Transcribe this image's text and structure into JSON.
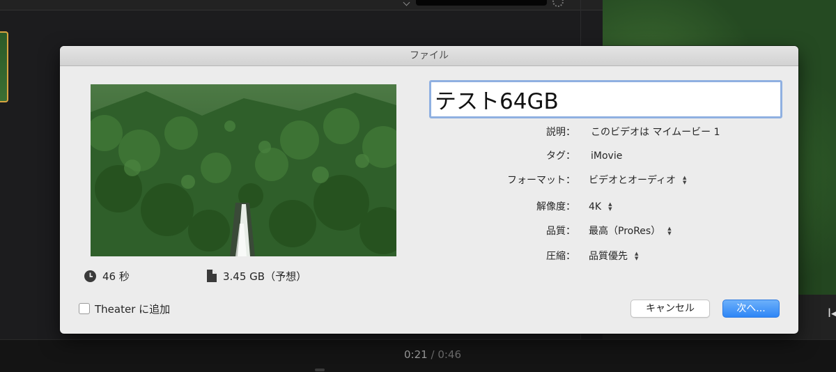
{
  "dialog": {
    "window_title": "ファイル",
    "title_field_value": "テスト64GB",
    "duration": "46 秒",
    "filesize": "3.45 GB（予想）",
    "description_label": "説明：",
    "description_value": "このビデオは マイムービー 1",
    "tags_label": "タグ：",
    "tags_value": "iMovie",
    "format_label": "フォーマット：",
    "format_value": "ビデオとオーディオ",
    "resolution_label": "解像度：",
    "resolution_value": "4K",
    "quality_label": "品質：",
    "quality_value": "最高（ProRes）",
    "compression_label": "圧縮：",
    "compression_value": "品質優先",
    "theater_label": "Theater に追加",
    "theater_checked": false,
    "cancel_label": "キャンセル",
    "next_label": "次へ..."
  },
  "background": {
    "timecode_current": "0:21",
    "timecode_separator": "/",
    "timecode_total": "0:46",
    "viewer_mark": "I◂"
  },
  "icons": {
    "clock": "clock-icon",
    "file": "file-icon",
    "stepper": "stepper-arrows-icon",
    "gear": "gear-icon"
  },
  "colors": {
    "primary_button": "#2e86f6",
    "focus_ring": "#8fb0e1",
    "dialog_background": "#ececec"
  }
}
